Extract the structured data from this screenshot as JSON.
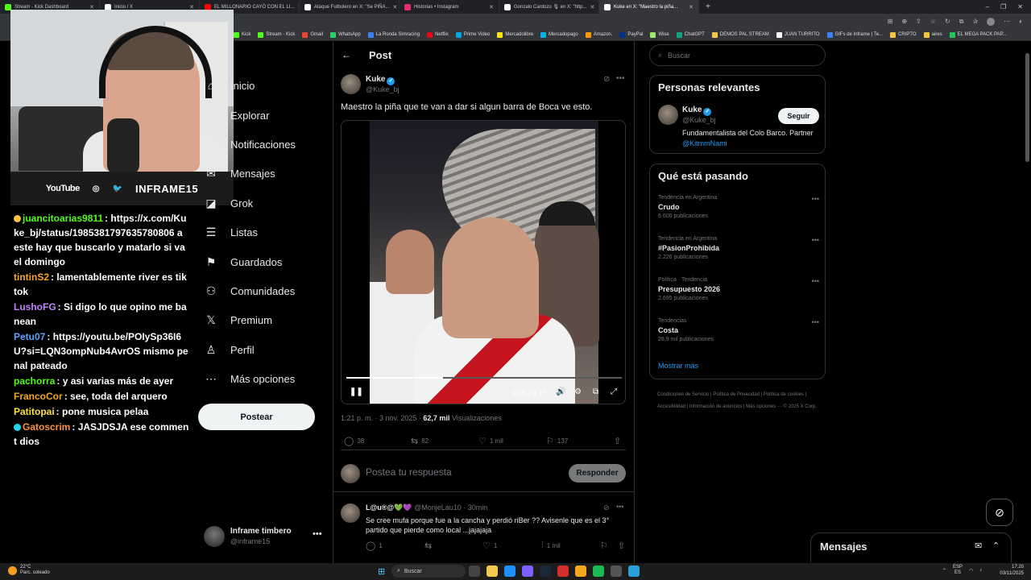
{
  "browser": {
    "tabs": [
      {
        "title": "Stream - Kick Dashboard",
        "color": "#53fc18",
        "active": false
      },
      {
        "title": "Inicio / X",
        "color": "#ffffff",
        "active": false
      },
      {
        "title": "EL MILLONARIO CAYÓ CON EL LI...",
        "color": "#ff0000",
        "active": false
      },
      {
        "title": "Ataque Futbolero en X: \"Se PIÑA...",
        "color": "#ffffff",
        "active": false
      },
      {
        "title": "Historias • Instagram",
        "color": "#e1306c",
        "active": false
      },
      {
        "title": "Gonzalo Cardozo 🎙 en X: \"http...",
        "color": "#ffffff",
        "active": false
      },
      {
        "title": "Kuke en X: \"Maestro la piña...",
        "color": "#ffffff",
        "active": true
      }
    ],
    "new_tab": "+",
    "window_controls": [
      "–",
      "❐",
      "✕"
    ],
    "bookmarks": [
      {
        "label": "Kick",
        "color": "#53fc18"
      },
      {
        "label": "Stream - Kick",
        "color": "#53fc18"
      },
      {
        "label": "Gmail",
        "color": "#ea4335"
      },
      {
        "label": "WhatsApp",
        "color": "#25d366"
      },
      {
        "label": "La Ronda Simracing",
        "color": "#3b82f6"
      },
      {
        "label": "Netflix",
        "color": "#e50914"
      },
      {
        "label": "Prime Video",
        "color": "#00a8e1"
      },
      {
        "label": "Mercadolibre",
        "color": "#ffe600"
      },
      {
        "label": "Mercadopago",
        "color": "#00b1ea"
      },
      {
        "label": "Amazon.",
        "color": "#ff9900"
      },
      {
        "label": "PayPal",
        "color": "#003087"
      },
      {
        "label": "Wise",
        "color": "#9fe870"
      },
      {
        "label": "ChatGPT",
        "color": "#10a37f"
      },
      {
        "label": "DEMOS PAL STREAM",
        "color": "#f5c542"
      },
      {
        "label": "JUAN TURRITO",
        "color": "#ffffff"
      },
      {
        "label": "GIFs de Inframe | Te...",
        "color": "#3b82f6"
      },
      {
        "label": "CRIPTO",
        "color": "#f5c542"
      },
      {
        "label": "aires",
        "color": "#f5c542"
      },
      {
        "label": "EL MEGA PACK PAP...",
        "color": "#22c55e"
      }
    ]
  },
  "stream_overlay": {
    "youtube": "YouTube",
    "brand": "INFRAME15",
    "chat": [
      {
        "user": "juancitoarias9811",
        "text": ": https://x.com/Kuke_bj/status/1985381797635780806 a este hay que buscarlo y matarlo si va el domingo",
        "color": "#53fc18",
        "badge": "#f5c542"
      },
      {
        "user": "tintinS2",
        "text": ": lamentablemente river es tiktok",
        "color": "#f5a623",
        "badge": ""
      },
      {
        "user": "LushoFG",
        "text": ": Si digo lo que opino me banean",
        "color": "#c084fc",
        "badge": ""
      },
      {
        "user": "Petu07",
        "text": ": https://youtu.be/POIySp36I6U?si=LQN3ompNub4AvrOS mismo penal pateado",
        "color": "#60a5fa",
        "badge": ""
      },
      {
        "user": "pachorra",
        "text": ": y asi varias más de ayer",
        "color": "#53fc18",
        "badge": ""
      },
      {
        "user": "FrancoCor",
        "text": ": see, toda del arquero",
        "color": "#f5a623",
        "badge": ""
      },
      {
        "user": "Patitopai",
        "text": ": pone musica pelaa",
        "color": "#fde047",
        "badge": ""
      },
      {
        "user": "Gatoscrim",
        "text": ": JASJDSJA ese comment dios",
        "color": "#fb923c",
        "badge": "#22d3ee"
      }
    ]
  },
  "nav": {
    "items": [
      {
        "label": "Inicio",
        "icon": "⌂"
      },
      {
        "label": "Explorar",
        "icon": "⌕"
      },
      {
        "label": "Notificaciones",
        "icon": "♢"
      },
      {
        "label": "Mensajes",
        "icon": "✉"
      },
      {
        "label": "Grok",
        "icon": "◪"
      },
      {
        "label": "Listas",
        "icon": "☰"
      },
      {
        "label": "Guardados",
        "icon": "⚑"
      },
      {
        "label": "Comunidades",
        "icon": "⚇"
      },
      {
        "label": "Premium",
        "icon": "𝕏"
      },
      {
        "label": "Perfil",
        "icon": "♙"
      },
      {
        "label": "Más opciones",
        "icon": "⋯"
      }
    ],
    "post_button": "Postear",
    "account_name": "Inframe timbero",
    "account_handle": "@inframe15",
    "account_more": "•••"
  },
  "post": {
    "header": "Post",
    "author_name": "Kuke",
    "author_handle": "@Kuke_bj",
    "text": "Maestro la piña que te van a dar si algun barra de Boca ve esto.",
    "video_time": "0:06 / 0:17",
    "video_progress": 0.35,
    "timestamp": "1:21 p. m. · 3 nov. 2025 ·",
    "views": "62,7 mil",
    "views_label": "Visualizaciones",
    "replies": "38",
    "reposts": "82",
    "likes": "1 mil",
    "bookmarks": "137",
    "reply_placeholder": "Postea tu respuesta",
    "reply_button": "Responder"
  },
  "reply": {
    "name": "L@u®@💚💜",
    "handle": "@MonjeLau10 · 30min",
    "text": "Se cree mufa porque fue a la cancha y perdió riBer ?? Avisenle que es el 3° partido que pierde como local ...jajajaja",
    "replies": "1",
    "reposts": "",
    "likes": "1",
    "views": "1 mil"
  },
  "sidebar": {
    "search_placeholder": "Buscar",
    "relevant_title": "Personas relevantes",
    "relevant_name": "Kuke",
    "relevant_handle": "@Kuke_bj",
    "follow_button": "Seguir",
    "relevant_bio": "Fundamentalista del Colo Barco. Partner ",
    "relevant_bio_link": "@KitmmNami",
    "trends_title": "Qué está pasando",
    "trends": [
      {
        "context": "Tendencia en Argentina",
        "name": "Crudo",
        "count": "6.600 publicaciones"
      },
      {
        "context": "Tendencia en Argentina",
        "name": "#PasionProhibida",
        "count": "2.226 publicaciones"
      },
      {
        "context": "Política · Tendencia",
        "name": "Presupuesto 2026",
        "count": "2.695 publicaciones"
      },
      {
        "context": "Tendencias",
        "name": "Costa",
        "count": "28,9 mil publicaciones"
      }
    ],
    "show_more": "Mostrar más",
    "footer": "Condiciones de Servicio  |  Política de Privacidad  |  Política de cookies  |  Accesibilidad  |  Información de anuncios  |  Más opciones ···  © 2025 X Corp.",
    "messages_title": "Mensajes"
  },
  "taskbar": {
    "temp": "22°C",
    "weather": "Parc. soleado",
    "search": "Buscar",
    "lang_top": "ESP",
    "lang_bottom": "ES",
    "time": "17:20",
    "date": "03/11/2025"
  }
}
